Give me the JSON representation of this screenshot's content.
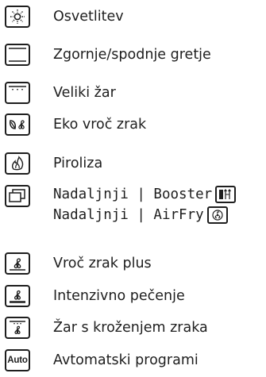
{
  "options": [
    {
      "icon": "oven-light-icon",
      "label": "Osvetlitev"
    },
    {
      "icon": "top-bottom-heat-icon",
      "label": "Zgornje/spodnje gretje"
    },
    {
      "icon": "large-grill-icon",
      "label": "Veliki žar"
    },
    {
      "icon": "eco-hot-air-icon",
      "label": "Eko vroč zrak"
    },
    {
      "icon": "pyrolysis-icon",
      "label": "Piroliza"
    },
    {
      "icon": "extra-function-icon",
      "label_line1": "Nadaljnji | Booster",
      "label_line2": "Nadaljnji | AirFry",
      "badge1_icon": "booster-icon",
      "badge2_icon": "airfry-icon"
    },
    {
      "icon": "hot-air-plus-icon",
      "label": "Vroč zrak plus"
    },
    {
      "icon": "intensive-baking-icon",
      "label": "Intenzivno pečenje"
    },
    {
      "icon": "grill-circulated-air-icon",
      "label": "Žar s kroženjem zraka"
    },
    {
      "icon": "auto-programs-icon",
      "icon_text": "Auto",
      "label": "Avtomatski programi"
    }
  ]
}
